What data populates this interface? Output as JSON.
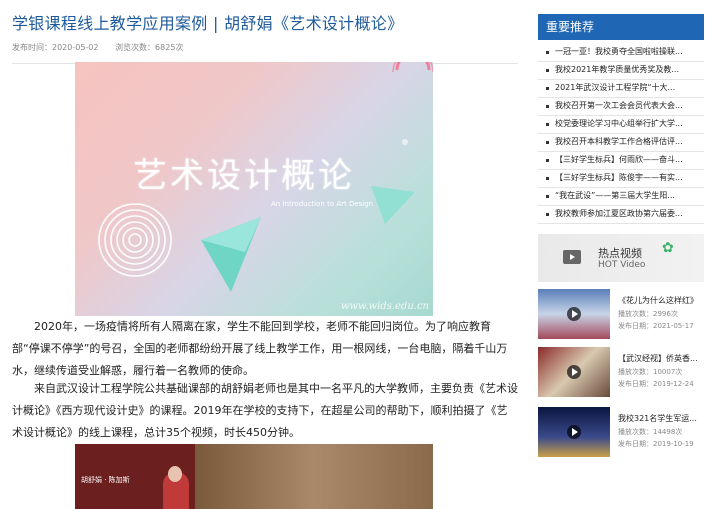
{
  "article": {
    "title": "学银课程线上教学应用案例 | 胡舒娟《艺术设计概论》",
    "publish_label": "发布时间：2020-05-02",
    "views_label": "浏览次数：6825次",
    "cover": {
      "title": "艺术设计概论",
      "subtitle": "An Introduction to Art Design",
      "watermark": "www.wids.edu.cn"
    },
    "paragraphs": [
      "2020年，一场疫情将所有人隔离在家，学生不能回到学校，老师不能回归岗位。为了响应教育部“停课不停学”的号召，全国的老师都纷纷开展了线上教学工作，用一根网线，一台电脑，隔着千山万水，继续传道受业解惑，履行着一名教师的使命。",
      "来自武汉设计工程学院公共基础课部的胡舒娟老师也是其中一名平凡的大学教师，主要负责《艺术设计概论》《西方现代设计史》的课程。2019年在学校的支持下，在超星公司的帮助下，顺利拍摄了《艺术设计概论》的线上课程，总计35个视频，时长450分钟。"
    ],
    "video_caption": "胡舒娟 · 陈加斯"
  },
  "sidebar": {
    "recommend_title": "重要推荐",
    "items": [
      "一冠一亚！我校勇夺全国啦啦操联...",
      "我校2021年教学质量优秀奖及教...",
      "2021年武汉设计工程学院“十大...",
      "我校召开第一次工会会员代表大会...",
      "校党委理论学习中心组举行扩大学...",
      "我校召开本科教学工作合格评估评...",
      "【三好学生标兵】何雨欣——奋斗...",
      "【三好学生标兵】陈俊宇——有实...",
      "“我在武设”——第三届大学生阳...",
      "我校教师参加江夏区政协第六届委..."
    ],
    "hot_video": {
      "title": "热点视频",
      "subtitle": "HOT Video"
    },
    "videos": [
      {
        "title": "《花儿为什么这样红》",
        "plays": "播放次数：2996次",
        "date": "发布日期：2021-05-17"
      },
      {
        "title": "【武汉经视】侨英香...",
        "plays": "播放次数：10007次",
        "date": "发布日期：2019-12-24"
      },
      {
        "title": "我校321名学生军运...",
        "plays": "播放次数：14498次",
        "date": "发布日期：2019-10-19"
      }
    ]
  }
}
